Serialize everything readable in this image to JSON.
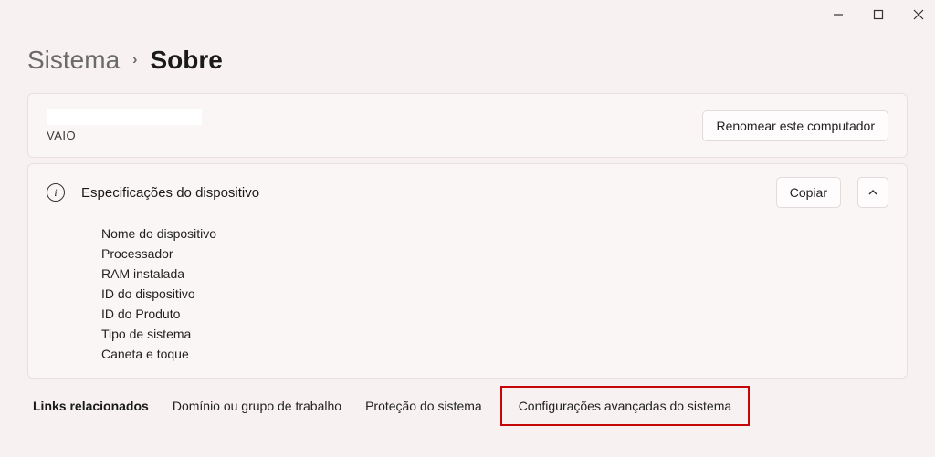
{
  "breadcrumb": {
    "parent": "Sistema",
    "current": "Sobre"
  },
  "pc": {
    "brand": "VAIO",
    "rename_button": "Renomear este computador"
  },
  "device_specs": {
    "title": "Especificações do dispositivo",
    "copy_button": "Copiar",
    "rows": {
      "device_name": "Nome do dispositivo",
      "processor": "Processador",
      "ram": "RAM instalada",
      "device_id": "ID do dispositivo",
      "product_id": "ID do Produto",
      "system_type": "Tipo de sistema",
      "pen_touch": "Caneta e toque"
    }
  },
  "related_links": {
    "heading": "Links relacionados",
    "domain": "Domínio ou grupo de trabalho",
    "protection": "Proteção do sistema",
    "advanced": "Configurações avançadas do sistema"
  }
}
